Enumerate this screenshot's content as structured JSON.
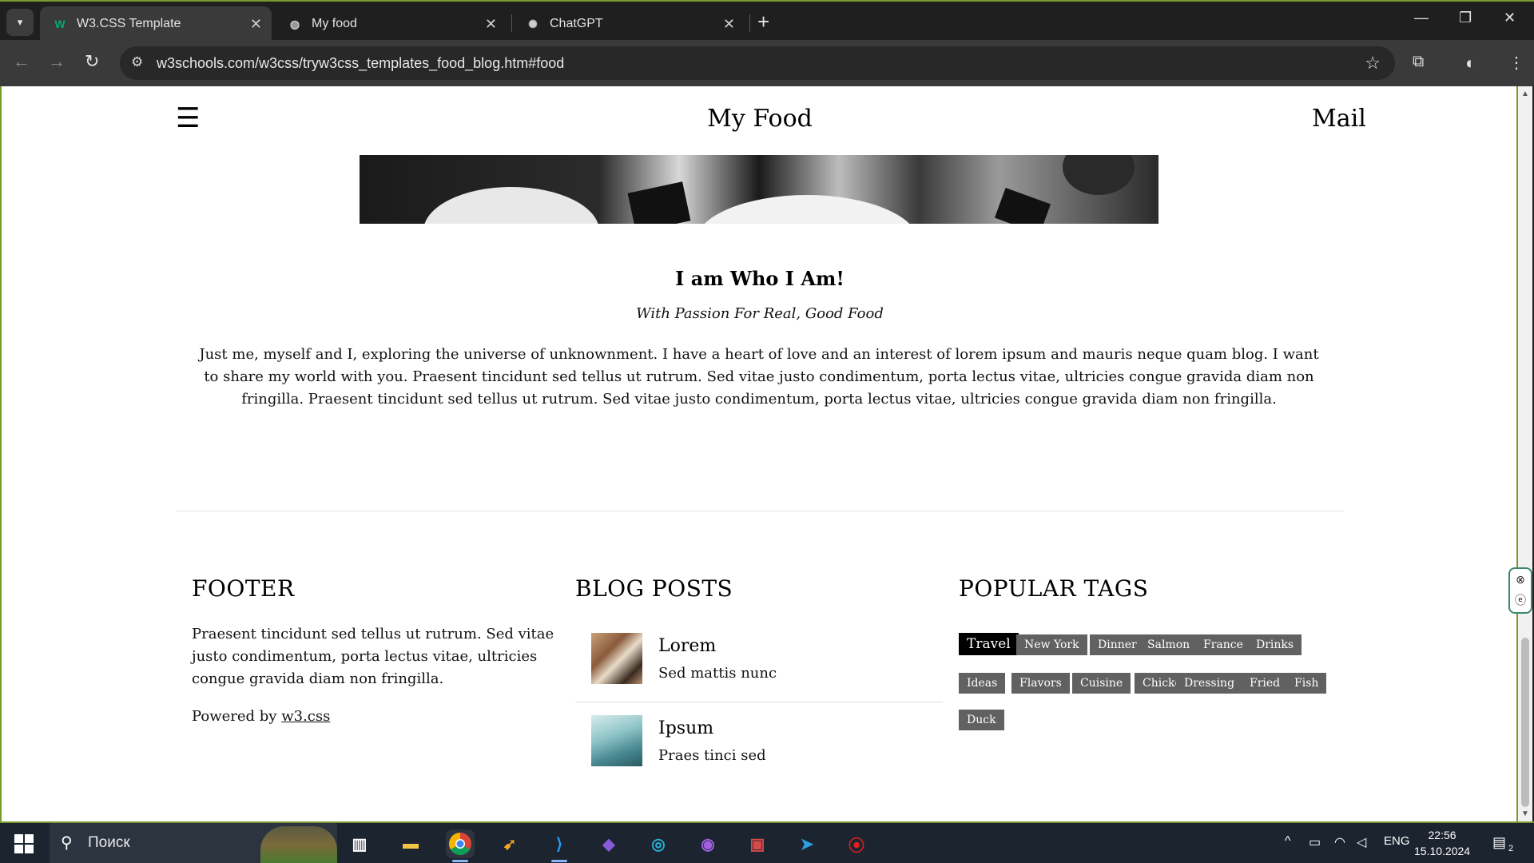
{
  "browser": {
    "tabs": [
      {
        "title": "W3.CSS Template",
        "active": true
      },
      {
        "title": "My food",
        "active": false
      },
      {
        "title": "ChatGPT",
        "active": false
      }
    ],
    "url": "w3schools.com/w3css/tryw3css_templates_food_blog.htm#food"
  },
  "page": {
    "site_title": "My Food",
    "mail_label": "Mail",
    "about_heading": "I am Who I Am!",
    "about_sub": "With Passion For Real, Good Food",
    "about_text": "Just me, myself and I, exploring the universe of unknownment. I have a heart of love and an interest of lorem ipsum and mauris neque quam blog. I want to share my world with you. Praesent tincidunt sed tellus ut rutrum. Sed vitae justo condimentum, porta lectus vitae, ultricies congue gravida diam non fringilla. Praesent tincidunt sed tellus ut rutrum. Sed vitae justo condimentum, porta lectus vitae, ultricies congue gravida diam non fringilla.",
    "footer": {
      "title": "FOOTER",
      "text": "Praesent tincidunt sed tellus ut rutrum. Sed vitae justo condimentum, porta lectus vitae, ultricies congue gravida diam non fringilla.",
      "powered_prefix": "Powered by",
      "powered_link": "w3.css"
    },
    "blog_posts": {
      "title": "BLOG POSTS",
      "posts": [
        {
          "title": "Lorem",
          "subtitle": "Sed mattis nunc"
        },
        {
          "title": "Ipsum",
          "subtitle": "Praes tinci sed"
        }
      ]
    },
    "popular_tags": {
      "title": "POPULAR TAGS",
      "tags": [
        "Travel",
        "New York",
        "Dinner",
        "Salmon",
        "France",
        "Drinks",
        "Ideas",
        "Flavors",
        "Cuisine",
        "Chicken",
        "Dressing",
        "Fried",
        "Fish",
        "Duck"
      ]
    }
  },
  "taskbar": {
    "search_placeholder": "Поиск",
    "language": "ENG",
    "time": "22:56",
    "date": "15.10.2024",
    "notifications": "2"
  }
}
